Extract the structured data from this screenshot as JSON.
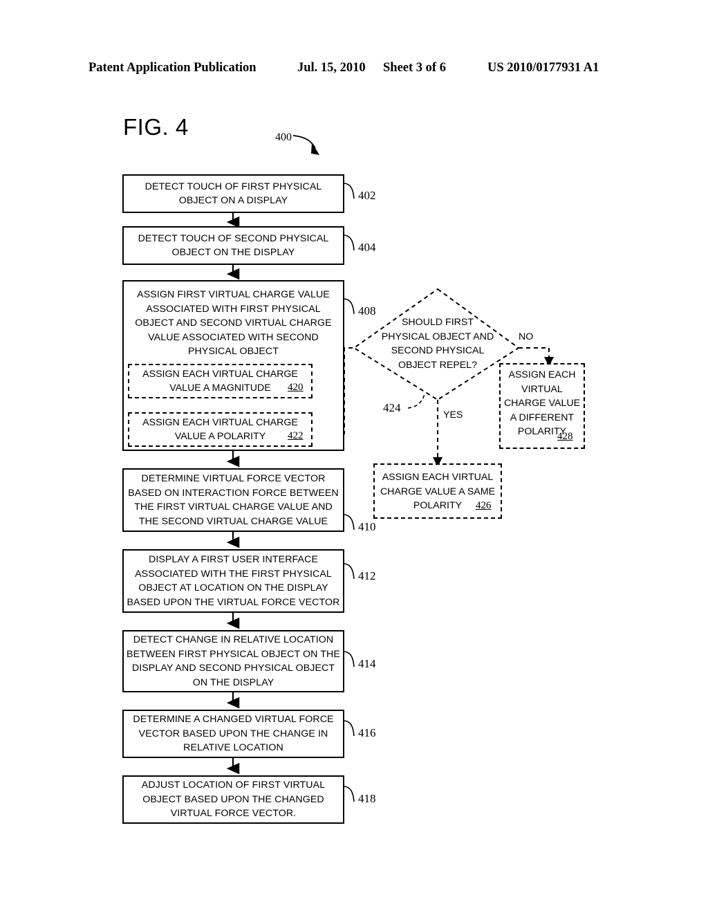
{
  "header": {
    "title": "Patent Application Publication",
    "date": "Jul. 15, 2010",
    "sheet": "Sheet 3 of 6",
    "patent_number": "US 2010/0177931 A1"
  },
  "figure": {
    "label": "FIG. 4",
    "reference": "400"
  },
  "flow": {
    "nodes": [
      {
        "id": "402",
        "ref": "402",
        "type": "process",
        "text": "DETECT TOUCH OF FIRST PHYSICAL OBJECT ON A DISPLAY"
      },
      {
        "id": "404",
        "ref": "404",
        "type": "process",
        "text": "DETECT TOUCH OF SECOND PHYSICAL OBJECT ON THE DISPLAY"
      },
      {
        "id": "408",
        "ref": "408",
        "type": "process",
        "text": "ASSIGN FIRST VIRTUAL CHARGE VALUE ASSOCIATED WITH FIRST PHYSICAL OBJECT AND SECOND VIRTUAL CHARGE VALUE ASSOCIATED WITH SECOND PHYSICAL OBJECT"
      },
      {
        "id": "420",
        "ref": "420",
        "type": "sub-process-dashed",
        "text": "ASSIGN EACH VIRTUAL CHARGE VALUE A MAGNITUDE"
      },
      {
        "id": "422",
        "ref": "422",
        "type": "sub-process-dashed",
        "text": "ASSIGN EACH VIRTUAL CHARGE VALUE A POLARITY"
      },
      {
        "id": "424",
        "ref": "424",
        "type": "decision-dashed",
        "text": "SHOULD FIRST PHYSICAL OBJECT AND SECOND PHYSICAL OBJECT REPEL?"
      },
      {
        "id": "428",
        "ref": "428",
        "type": "process-dashed",
        "text": "ASSIGN EACH VIRTUAL CHARGE VALUE A DIFFERENT POLARITY"
      },
      {
        "id": "426",
        "ref": "426",
        "type": "process-dashed",
        "text": "ASSIGN EACH VIRTUAL CHARGE VALUE A SAME POLARITY"
      },
      {
        "id": "410",
        "ref": "410",
        "type": "process",
        "text": "DETERMINE VIRTUAL FORCE VECTOR BASED ON INTERACTION FORCE BETWEEN THE FIRST VIRTUAL CHARGE VALUE AND THE SECOND VIRTUAL CHARGE VALUE"
      },
      {
        "id": "412",
        "ref": "412",
        "type": "process",
        "text": "DISPLAY A FIRST USER INTERFACE ASSOCIATED WITH THE FIRST PHYSICAL OBJECT AT LOCATION ON THE DISPLAY BASED UPON THE VIRTUAL FORCE VECTOR"
      },
      {
        "id": "414",
        "ref": "414",
        "type": "process",
        "text": "DETECT CHANGE IN RELATIVE LOCATION BETWEEN FIRST PHYSICAL OBJECT ON THE DISPLAY AND SECOND PHYSICAL OBJECT ON THE DISPLAY"
      },
      {
        "id": "416",
        "ref": "416",
        "type": "process",
        "text": "DETERMINE A CHANGED VIRTUAL FORCE VECTOR BASED UPON THE CHANGE IN RELATIVE LOCATION"
      },
      {
        "id": "418",
        "ref": "418",
        "type": "process",
        "text": "ADJUST LOCATION OF FIRST VIRTUAL OBJECT BASED UPON THE CHANGED VIRTUAL FORCE VECTOR."
      }
    ],
    "branch_labels": {
      "yes": "YES",
      "no": "NO"
    }
  }
}
